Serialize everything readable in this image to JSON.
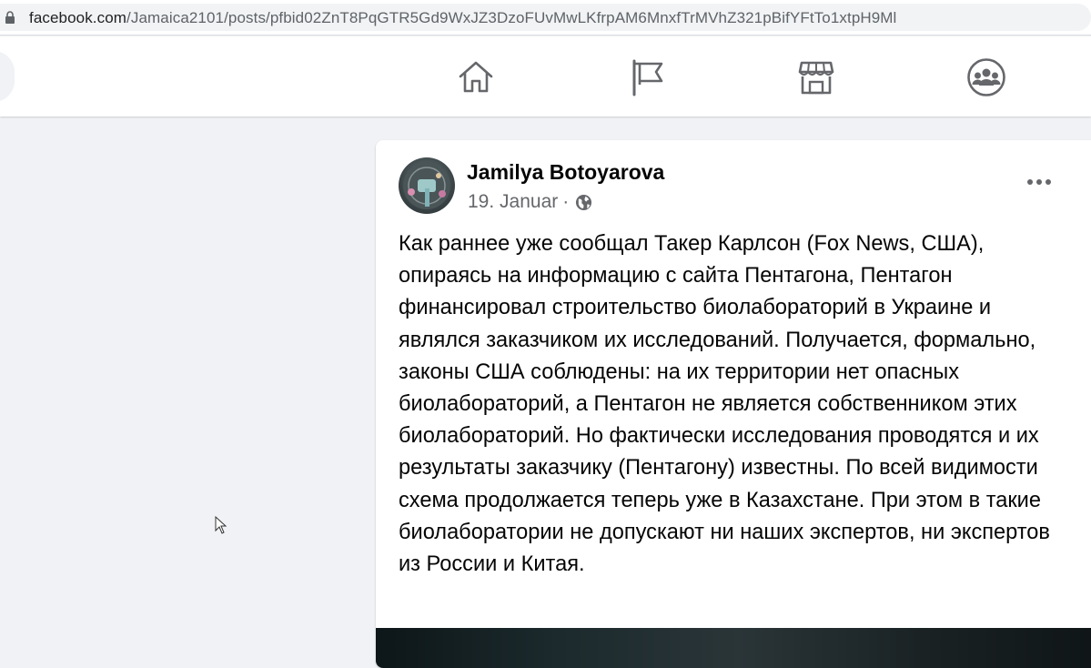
{
  "browser": {
    "url_host": "facebook.com",
    "url_path": "/Jamaica2101/posts/pfbid02ZnT8PqGTR5Gd9WxJZ3DzoFUvMwLKfrpAM6MnxfTrMVhZ321pBifYFtTo1xtpH9Ml",
    "lock_icon": "lock-icon"
  },
  "nav": {
    "items": [
      {
        "icon": "home-icon"
      },
      {
        "icon": "flag-icon"
      },
      {
        "icon": "marketplace-icon"
      },
      {
        "icon": "groups-icon"
      }
    ]
  },
  "post": {
    "author": "Jamilya Botoyarova",
    "date": "19. Januar",
    "separator": "·",
    "privacy_icon": "globe-icon",
    "menu_icon": "more-icon",
    "text": "Как раннее уже сообщал Такер Карлсон (Fox News, США), опираясь на информацию с сайта Пентагона, Пентагон финансировал строительство биолабораторий в Украине и являлся заказчиком их исследований. Получается, формально, законы США соблюдены: на их территории нет опасных биолабораторий, а Пентагон не является собственником этих биолабораторий. Но фактически исследования проводятся и их результаты заказчику (Пентагону) известны. По всей видимости схема продолжается теперь уже в Казахстане. При этом в такие биолаборатории не допускают ни наших экспертов, ни экспертов из России и Китая."
  },
  "colors": {
    "page_bg": "#f0f2f5",
    "icon_gray": "#65676b",
    "text_primary": "#050505"
  }
}
